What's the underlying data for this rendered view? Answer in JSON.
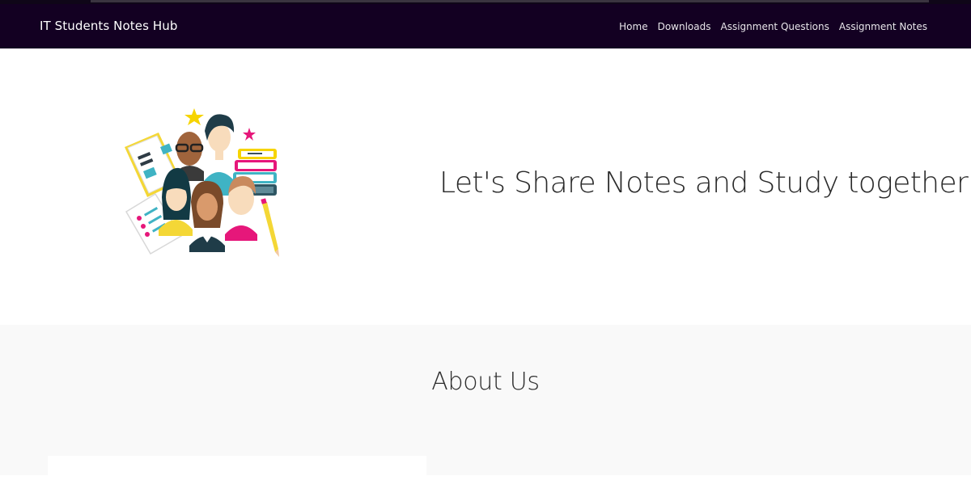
{
  "navbar": {
    "brand": "IT Students Notes Hub",
    "links": [
      "Home",
      "Downloads",
      "Assignment Questions",
      "Assignment Notes"
    ]
  },
  "hero": {
    "title": "Let's Share Notes and Study together",
    "illustration": "students-group-illustration"
  },
  "about": {
    "title": "About Us"
  },
  "colors": {
    "navbar_bg": "#130022",
    "about_bg": "#f9f9f9",
    "accent_pink": "#e6177a",
    "accent_yellow": "#f6d400",
    "accent_teal": "#3fb3c4"
  }
}
